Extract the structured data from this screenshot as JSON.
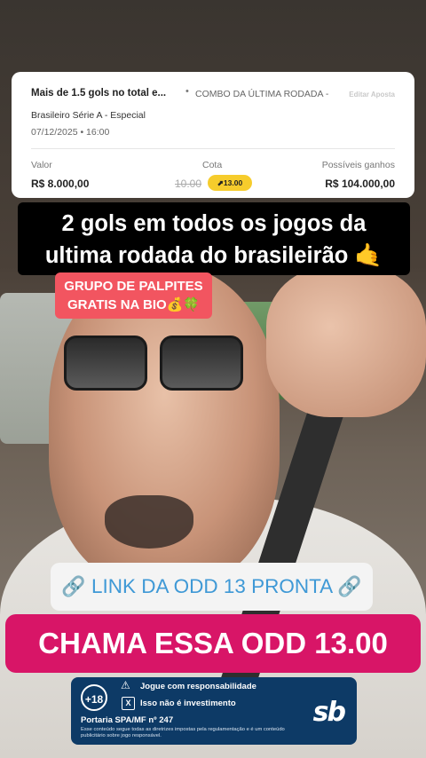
{
  "bet_card": {
    "title": "Mais de 1.5 gols no total e...",
    "combo": "COMBO DA ÚLTIMA RODADA -",
    "edit_label": "Editar Aposta",
    "league": "Brasileiro Série A - Especial",
    "datetime": "07/12/2025 • 16:00",
    "value_label": "Valor",
    "value": "R$ 8.000,00",
    "odd_label": "Cota",
    "old_odd": "10.00",
    "new_odd": "13.00",
    "payout_label": "Possíveis ganhos",
    "payout": "R$ 104.000,00"
  },
  "captions": {
    "main_line1": "2 gols em todos os jogos da",
    "main_line2": "ultima rodada do brasileirão 🤙",
    "promo_line1": "GRUPO DE PALPITES",
    "promo_line2": "GRATIS NA BIO",
    "promo_emoji": "💰🍀",
    "link_text": "LINK DA ODD 13 PRONTA",
    "odd_text": "CHAMA ESSA ODD 13.00"
  },
  "responsibility": {
    "age": "+18",
    "warning": "Jogue com responsabilidade",
    "not_investment": "Isso não é investimento",
    "x_mark": "X",
    "portaria": "Portaria SPA/MF nº 247",
    "disclaimer": "Esse conteúdo segue todas as diretrizes impostas pela regulamentação e é um conteúdo publicitário sobre jogo responsável.",
    "brand": "sb"
  },
  "icons": {
    "link": "link-icon",
    "chain": "chain-icon",
    "warning": "warning-icon"
  },
  "colors": {
    "odd_pill": "#f6cc2c",
    "promo_red": "#f25560",
    "odd_magenta": "#d81567",
    "link_blue": "#3f99d6",
    "banner_navy": "#0d3a66"
  }
}
